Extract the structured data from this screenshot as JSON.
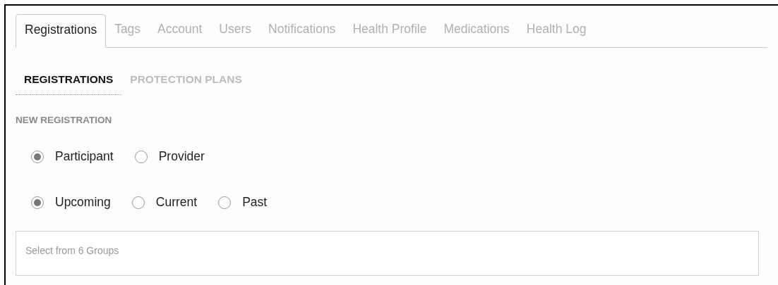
{
  "tabs": [
    {
      "label": "Registrations",
      "selected": true
    },
    {
      "label": "Tags",
      "selected": false
    },
    {
      "label": "Account",
      "selected": false
    },
    {
      "label": "Users",
      "selected": false
    },
    {
      "label": "Notifications",
      "selected": false
    },
    {
      "label": "Health Profile",
      "selected": false
    },
    {
      "label": "Medications",
      "selected": false
    },
    {
      "label": "Health Log",
      "selected": false
    }
  ],
  "subtabs": [
    {
      "label": "REGISTRATIONS",
      "selected": true
    },
    {
      "label": "PROTECTION PLANS",
      "selected": false
    }
  ],
  "section_title": "NEW REGISTRATION",
  "radio_groups": [
    [
      {
        "label": "Participant",
        "selected": true
      },
      {
        "label": "Provider",
        "selected": false
      }
    ],
    [
      {
        "label": "Upcoming",
        "selected": true
      },
      {
        "label": "Current",
        "selected": false
      },
      {
        "label": "Past",
        "selected": false
      }
    ]
  ],
  "group_select": {
    "placeholder": "Select from 6 Groups"
  }
}
